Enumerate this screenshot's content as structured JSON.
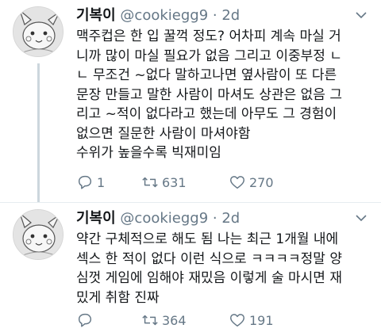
{
  "tweets": [
    {
      "name": "기복이",
      "handle": "@cookiegg9",
      "separator": "·",
      "time": "2d",
      "lines": [
        "맥주컵은 한 입 꿀꺽 정도? 어차피 계속 마실 거",
        "니까 많이 마실 필요가 없음 그리고 이중부정 ㄴ",
        "ㄴ 무조건 ~없다 말하고나면 옆사람이 또 다른",
        "문장 만들고 말한 사람이 마셔도 상관은 없음 그",
        "리고 ~적이 없다라고 했는데 아무도 그 경험이",
        "없으면 질문한 사람이 마셔야함",
        "수위가 높을수록 빅재미임"
      ],
      "reply_count": "1",
      "retweet_count": "631",
      "like_count": "270"
    },
    {
      "name": "기복이",
      "handle": "@cookiegg9",
      "separator": "·",
      "time": "2d",
      "lines": [
        "약간 구체적으로 해도 됨 나는 최근 1개월 내에",
        "섹스 한 적이 없다 이런 식으로 ㅋㅋㅋㅋ정말 양",
        "심껏 게임에 임해야 재밌음 이렇게 술 마시면 재",
        "밌게 취함 진짜"
      ],
      "reply_count": "",
      "retweet_count": "364",
      "like_count": "191"
    }
  ],
  "icons": {
    "reply": "reply-icon",
    "retweet": "retweet-icon",
    "like": "heart-icon",
    "more": "chevron-down-icon",
    "avatar": "pikachu-sketch-avatar"
  },
  "colors": {
    "text": "#14171a",
    "secondary": "#657786",
    "divider": "#e6ecf0",
    "thread_line": "#ccd6dd"
  }
}
